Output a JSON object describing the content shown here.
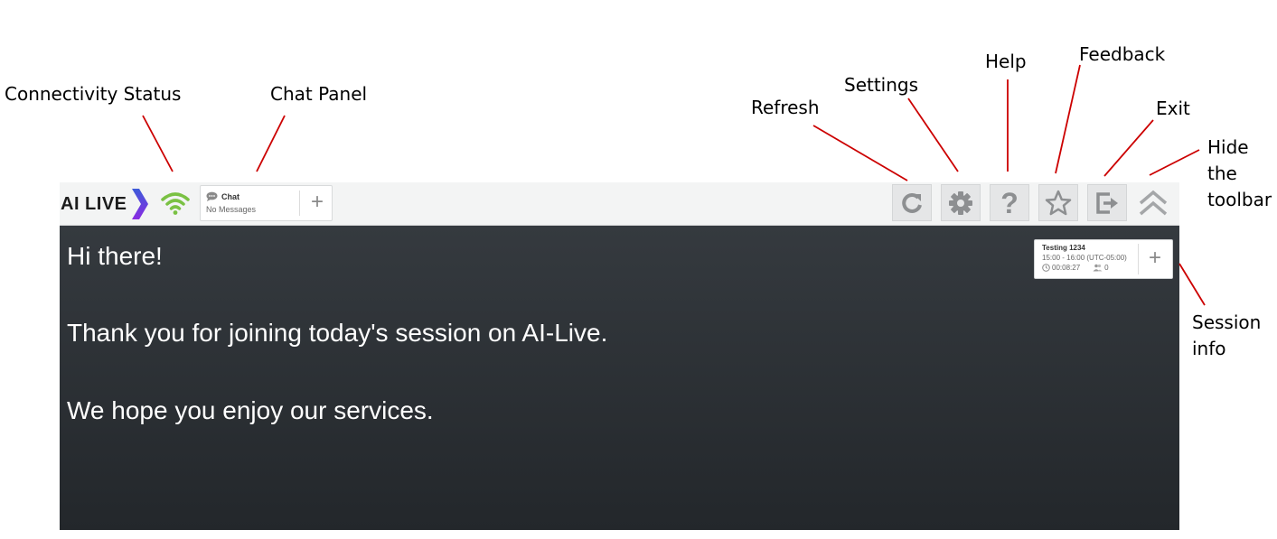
{
  "annotations": {
    "connectivity_status": "Connectivity Status",
    "chat_panel": "Chat Panel",
    "refresh": "Refresh",
    "settings": "Settings",
    "help": "Help",
    "feedback": "Feedback",
    "exit": "Exit",
    "hide_line1": "Hide",
    "hide_line2": "the",
    "hide_line3": "toolbar",
    "session_line1": "Session",
    "session_line2": "info",
    "leader_color": "#cc0000"
  },
  "toolbar": {
    "logo_text": "AI LIVE",
    "logo_chevron_colors": [
      "#3d5bd9",
      "#8a2be2"
    ],
    "wifi_color": "#7ac143",
    "chat": {
      "title": "Chat",
      "subtitle": "No Messages",
      "add_label": "+"
    },
    "buttons": [
      {
        "name": "refresh",
        "icon": "refresh-icon"
      },
      {
        "name": "settings",
        "icon": "gear-icon"
      },
      {
        "name": "help",
        "icon": "question-icon"
      },
      {
        "name": "feedback",
        "icon": "star-icon"
      },
      {
        "name": "exit",
        "icon": "exit-icon"
      },
      {
        "name": "hide-toolbar",
        "icon": "chevron-up-double-icon"
      }
    ]
  },
  "main": {
    "messages": [
      "Hi there!",
      "Thank you for joining today's session on AI-Live.",
      "We hope you enjoy our services."
    ]
  },
  "session": {
    "title": "Testing 1234",
    "time_range": "15:00 - 16:00 (UTC-05:00)",
    "elapsed": "00:08:27",
    "participants": "0",
    "add_label": "+"
  }
}
